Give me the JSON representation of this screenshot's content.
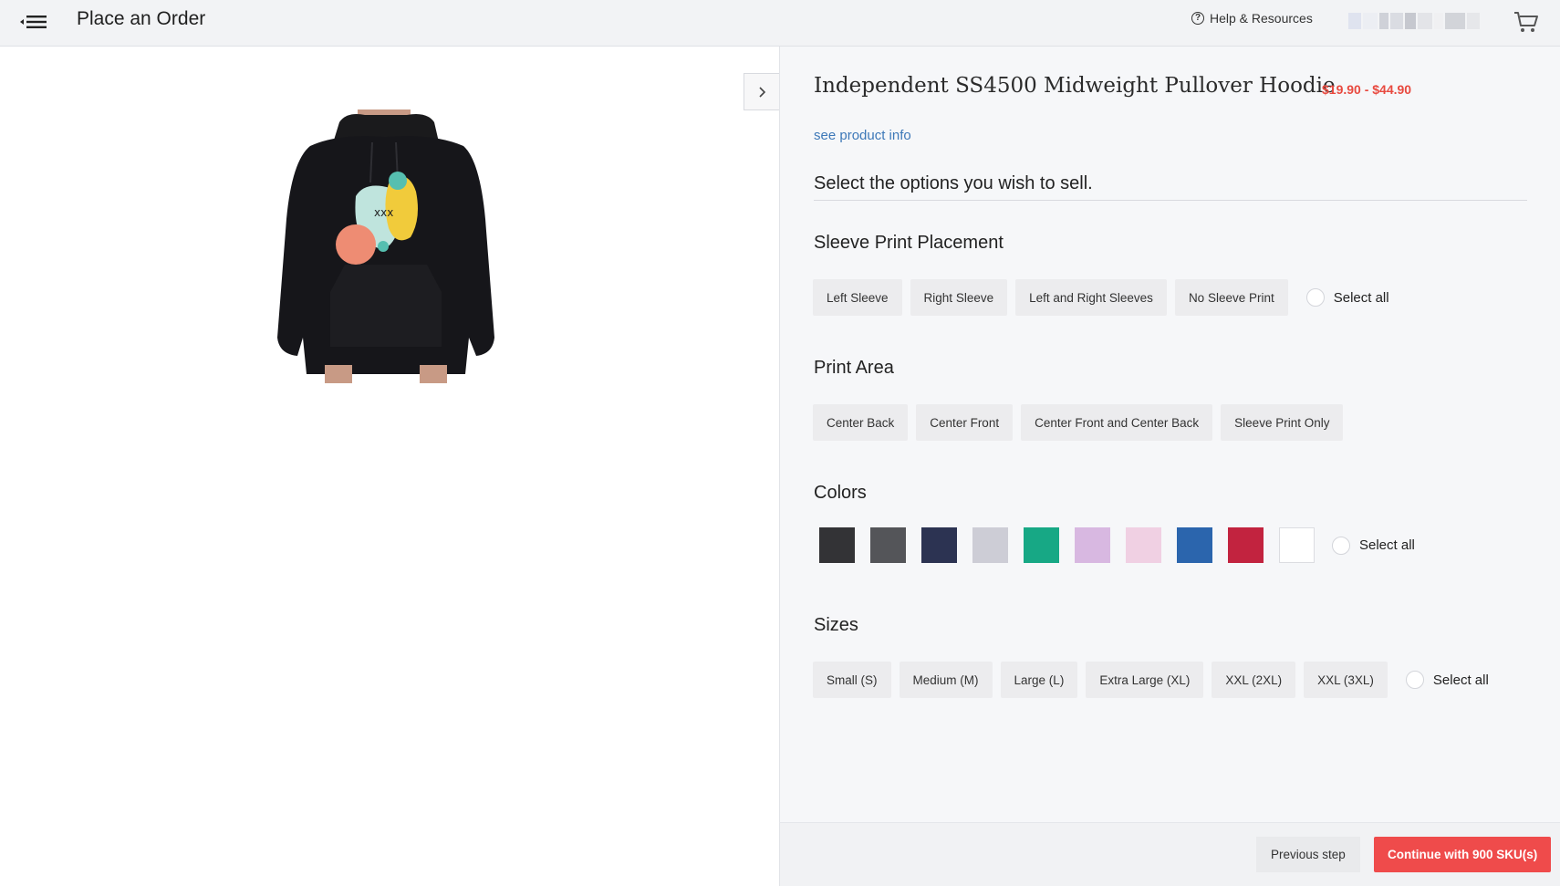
{
  "header": {
    "title": "Place an Order",
    "help_label": "Help & Resources",
    "menu_icon": "menu-collapse-icon",
    "cart_icon": "cart-icon"
  },
  "product": {
    "title": "Independent SS4500 Midweight Pullover Hoodie",
    "price": "$19.90 - $44.90",
    "info_link": "see product info",
    "instruction": "Select the options you wish to sell."
  },
  "sleeve": {
    "title": "Sleeve Print Placement",
    "options": [
      "Left Sleeve",
      "Right Sleeve",
      "Left and Right Sleeves",
      "No Sleeve Print"
    ],
    "select_all": "Select all"
  },
  "print_area": {
    "title": "Print Area",
    "options": [
      "Center Back",
      "Center Front",
      "Center Front and Center Back",
      "Sleeve Print Only"
    ]
  },
  "colors": {
    "title": "Colors",
    "swatches": [
      "#333336",
      "#545559",
      "#2c3352",
      "#cdcdd6",
      "#17a885",
      "#d8b8e1",
      "#f0d0e3",
      "#2b65ad",
      "#c2233f",
      "#ffffff"
    ],
    "select_all": "Select all"
  },
  "sizes": {
    "title": "Sizes",
    "options": [
      "Small (S)",
      "Medium (M)",
      "Large (L)",
      "Extra Large (XL)",
      "XXL (2XL)",
      "XXL (3XL)"
    ],
    "select_all": "Select all"
  },
  "footer": {
    "previous": "Previous step",
    "continue": "Continue with 900 SKU(s)"
  },
  "colors_theme": {
    "accent": "#ef4b4b",
    "price": "#e8493f",
    "link": "#3d78b8"
  }
}
